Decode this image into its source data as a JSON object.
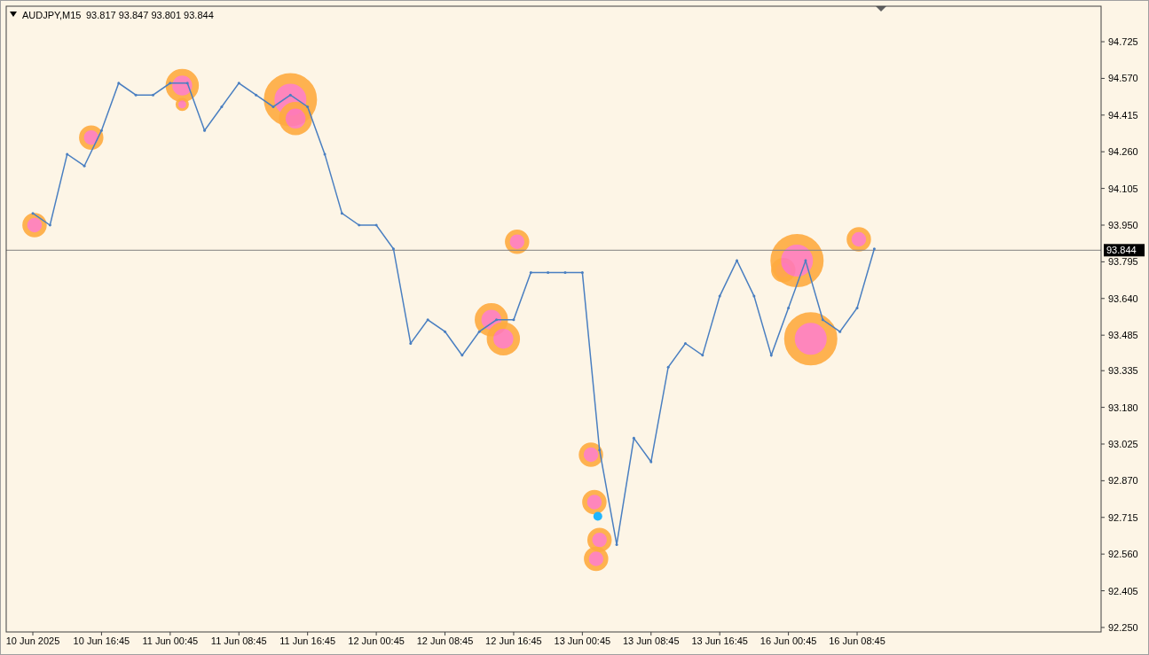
{
  "chart": {
    "symbol": "AUDJPY,M15",
    "ohlc": "93.817 93.847 93.801 93.844",
    "current_price": "93.844",
    "chart_data": {
      "type": "line",
      "categories": [
        "10 Jun 2025",
        null,
        null,
        null,
        "10 Jun 16:45",
        null,
        null,
        null,
        "11 Jun 00:45",
        null,
        null,
        null,
        "11 Jun 08:45",
        null,
        null,
        null,
        "11 Jun 16:45",
        null,
        null,
        null,
        "12 Jun 00:45",
        null,
        null,
        null,
        "12 Jun 08:45",
        null,
        null,
        null,
        "12 Jun 16:45",
        null,
        null,
        null,
        "13 Jun 00:45",
        null,
        null,
        null,
        "13 Jun 08:45",
        null,
        null,
        null,
        "13 Jun 16:45",
        null,
        null,
        null,
        "16 Jun 00:45",
        null,
        null,
        null,
        "16 Jun 08:45",
        null,
        null,
        null,
        null,
        null,
        null,
        null,
        null,
        null,
        null,
        null,
        null,
        null
      ],
      "series": [
        {
          "color": "#4a7fc1",
          "values": [
            94.0,
            93.95,
            94.25,
            94.2,
            94.35,
            94.55,
            94.5,
            94.5,
            94.55,
            94.55,
            94.35,
            94.45,
            94.55,
            94.5,
            94.45,
            94.5,
            94.45,
            94.25,
            94.0,
            93.95,
            93.95,
            93.85,
            93.45,
            93.55,
            93.5,
            93.4,
            93.5,
            93.55,
            93.55,
            93.75,
            93.75,
            93.75,
            93.75,
            93.0,
            92.6,
            93.05,
            92.95,
            93.35,
            93.45,
            93.4,
            93.65,
            93.8,
            93.65,
            93.4,
            93.6,
            93.8,
            93.55,
            93.5,
            93.6,
            93.85,
            null,
            null,
            null,
            null,
            null,
            null,
            null,
            null,
            null,
            null,
            null,
            null
          ]
        }
      ],
      "yticks": [
        {
          "value": 94.725,
          "label": "94.725"
        },
        {
          "value": 94.57,
          "label": "94.570"
        },
        {
          "value": 94.415,
          "label": "94.415"
        },
        {
          "value": 94.26,
          "label": "94.260"
        },
        {
          "value": 94.105,
          "label": "94.105"
        },
        {
          "value": 93.95,
          "label": "93.950"
        },
        {
          "value": 93.795,
          "label": "93.795"
        },
        {
          "value": 93.64,
          "label": "93.640"
        },
        {
          "value": 93.485,
          "label": "93.485"
        },
        {
          "value": 93.335,
          "label": "93.335"
        },
        {
          "value": 93.18,
          "label": "93.180"
        },
        {
          "value": 93.025,
          "label": "93.025"
        },
        {
          "value": 92.87,
          "label": "92.870"
        },
        {
          "value": 92.715,
          "label": "92.715"
        },
        {
          "value": 92.56,
          "label": "92.560"
        },
        {
          "value": 92.405,
          "label": "92.405"
        },
        {
          "value": 92.25,
          "label": "92.250"
        }
      ],
      "ylim": [
        92.231,
        94.875
      ]
    }
  }
}
